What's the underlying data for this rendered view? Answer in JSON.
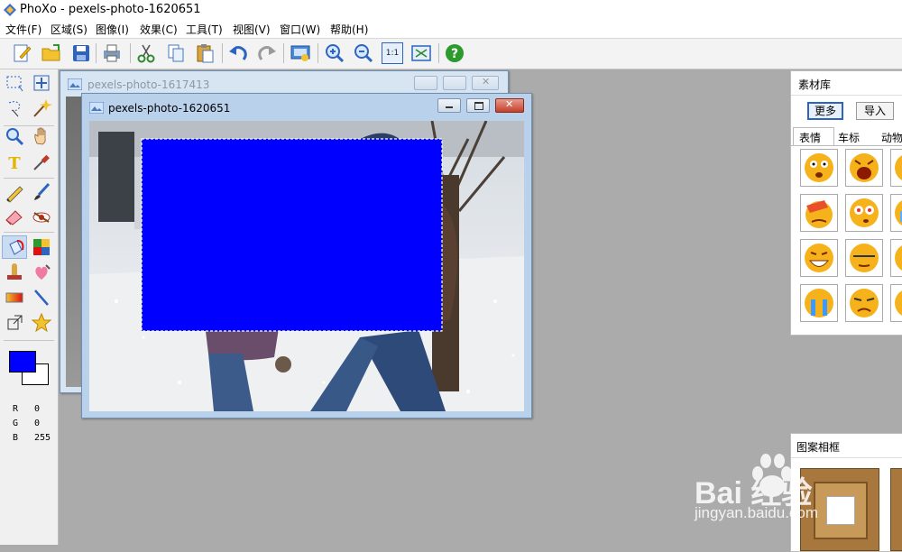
{
  "window": {
    "title": "PhoXo - pexels-photo-1620651"
  },
  "menu": [
    {
      "label": "文件(F)"
    },
    {
      "label": "区域(S)"
    },
    {
      "label": "图像(I)"
    },
    {
      "label": "效果(C)"
    },
    {
      "label": "工具(T)"
    },
    {
      "label": "视图(V)"
    },
    {
      "label": "窗口(W)"
    },
    {
      "label": "帮助(H)"
    }
  ],
  "toolbar": {
    "actual_size_label": "1:1"
  },
  "colors": {
    "foreground": "#0000ff",
    "background": "#ffffff",
    "selection_fill": "#0000ff",
    "title_active": "#b9d1ea",
    "title_inactive": "#d7e4f2"
  },
  "rgb": {
    "r_label": "R",
    "r_value": "0",
    "g_label": "G",
    "g_value": "0",
    "b_label": "B",
    "b_value": "255"
  },
  "doc_back": {
    "title": "pexels-photo-1617413"
  },
  "doc_front": {
    "title": "pexels-photo-1620651"
  },
  "material_panel": {
    "title": "素材库",
    "more_button": "更多",
    "import_button": "导入",
    "tabs": [
      {
        "label": "表情"
      },
      {
        "label": "车标"
      },
      {
        "label": "动物"
      }
    ]
  },
  "frame_panel": {
    "title": "图案相框"
  },
  "watermark": {
    "brand": "Bai 经验",
    "url": "jingyan.baidu.com"
  }
}
